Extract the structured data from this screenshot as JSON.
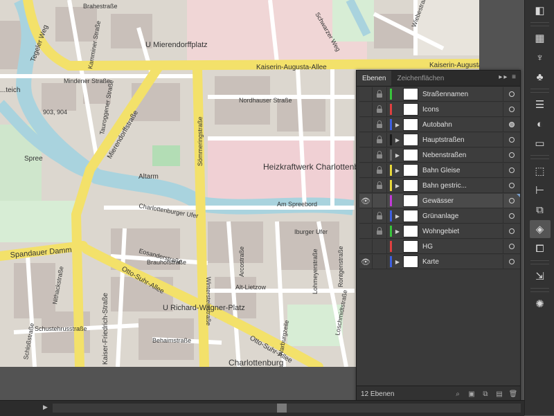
{
  "map": {
    "station_labels": [
      "U Mierendorffplatz",
      "U Richard-Wagner-Platz"
    ],
    "street_labels": [
      "Kaiserin-Augusta-Allee",
      "Tegeler Weg",
      "Mierendorffstraße",
      "Sömmeringstraße",
      "Nordhauser Straße",
      "Charlottenburger Ufer",
      "Am Spreebord",
      "Iburger Ufer",
      "Spandauer Damm",
      "Otto-Suhr-Allee",
      "Otto-Suhr-Allee",
      "Brahestraße",
      "Kaiser-Friedrich-Straße",
      "Alt-Lietzow",
      "Arcostraße",
      "Behaimstraße",
      "Schustehrusstraße",
      "Lohmeyerstraße",
      "Wintersteinstraße",
      "Kamminer Straße",
      "Mindener Straße",
      "Tauroggener Straße",
      "Warburgzeile",
      "Rontgenstraße",
      "Schwarzer Weg",
      "Wiebestraße",
      "Brauhofstraße",
      "Eosanderstraße",
      "Kaiser-Friedrich-Straße",
      "Loschmidtstraße",
      "Schloßstraße",
      "Nithackstraße"
    ],
    "place_labels": [
      "Heizkraftwerk Charlottenburg",
      "Charlottenburg",
      "Altarm",
      "Spree",
      "903, 904",
      "...teich"
    ]
  },
  "panel": {
    "tabs": [
      "Ebenen",
      "Zeichenflächen"
    ],
    "tab_controls": "▸▸ ≡",
    "layers": [
      {
        "name": "Straßennamen",
        "color": "#39c43c",
        "visible": false,
        "locked": true,
        "expandable": false,
        "target_filled": false
      },
      {
        "name": "Icons",
        "color": "#e04040",
        "visible": false,
        "locked": true,
        "expandable": false,
        "target_filled": false
      },
      {
        "name": "Autobahn",
        "color": "#3f5fe0",
        "visible": false,
        "locked": true,
        "expandable": true,
        "target_filled": true
      },
      {
        "name": "Hauptstraßen",
        "color": "#1a1a1a",
        "visible": false,
        "locked": true,
        "expandable": true,
        "target_filled": false
      },
      {
        "name": "Nebenstraßen",
        "color": "#6a6a6a",
        "visible": false,
        "locked": true,
        "expandable": true,
        "target_filled": false
      },
      {
        "name": "Bahn Gleise",
        "color": "#e8d83a",
        "visible": false,
        "locked": true,
        "expandable": true,
        "target_filled": false
      },
      {
        "name": "Bahn gestric...",
        "color": "#e8d83a",
        "visible": false,
        "locked": true,
        "expandable": true,
        "target_filled": false
      },
      {
        "name": "Gewässer",
        "color": "#c23ad8",
        "visible": true,
        "locked": false,
        "expandable": false,
        "target_filled": false,
        "selected": true
      },
      {
        "name": "Grünanlage",
        "color": "#3f5fe0",
        "visible": false,
        "locked": true,
        "expandable": true,
        "target_filled": false
      },
      {
        "name": "Wohngebiet",
        "color": "#39c43c",
        "visible": false,
        "locked": true,
        "expandable": true,
        "target_filled": false
      },
      {
        "name": "HG",
        "color": "#e04040",
        "visible": false,
        "locked": false,
        "expandable": false,
        "target_filled": false
      },
      {
        "name": "Karte",
        "color": "#3f5fe0",
        "visible": true,
        "locked": false,
        "expandable": true,
        "target_filled": false
      }
    ],
    "footer": {
      "count": "12 Ebenen",
      "icons": [
        "search-icon",
        "make-clipping-mask-icon",
        "new-sublayer-icon",
        "new-layer-icon",
        "delete-icon"
      ]
    }
  },
  "dock": {
    "icons": [
      "page-icon",
      "grid-icon",
      "brush-icon",
      "club-icon",
      "align-lines-icon",
      "color-circle-icon",
      "gradient-icon",
      "transform-icon",
      "align-icon",
      "pathfinder-icon",
      "layers-icon",
      "artboard-icon",
      "export-icon",
      "sun-icon"
    ]
  }
}
